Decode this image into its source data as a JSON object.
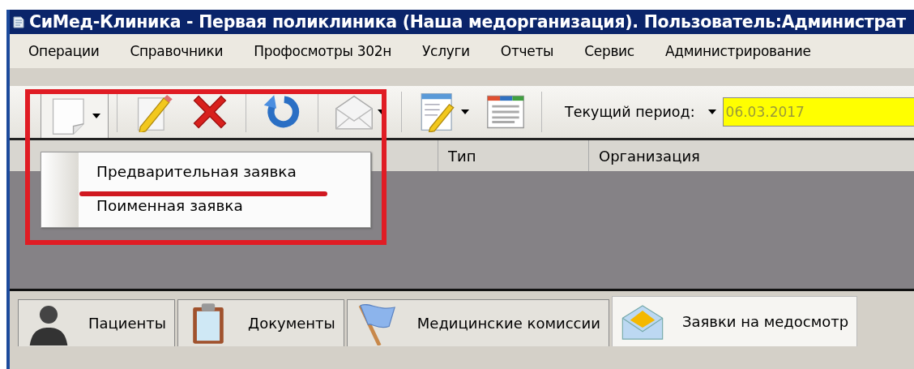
{
  "window": {
    "title": "СиМед-Клиника - Первая поликлиника (Наша медорганизация). Пользователь:Администрат"
  },
  "menu": [
    "Операции",
    "Справочники",
    "Профосмотры 302н",
    "Услуги",
    "Отчеты",
    "Сервис",
    "Администрирование"
  ],
  "toolbar": {
    "buttons": [
      {
        "kind": "new",
        "dropdown": true,
        "pressed": true
      },
      {
        "kind": "edit",
        "dropdown": false,
        "pressed": false
      },
      {
        "kind": "delete",
        "dropdown": false,
        "pressed": false
      },
      {
        "kind": "refresh",
        "dropdown": false,
        "pressed": false
      },
      {
        "kind": "mail",
        "dropdown": true,
        "pressed": false
      },
      {
        "kind": "list-edit",
        "dropdown": true,
        "pressed": false
      },
      {
        "kind": "form",
        "dropdown": false,
        "pressed": false
      }
    ],
    "period_label": "Текущий период:",
    "period_value": "06.03.2017"
  },
  "dropdown_menu": {
    "items": [
      {
        "label": "Предварительная заявка"
      },
      {
        "label": "Поименная заявка"
      }
    ]
  },
  "table": {
    "columns": [
      "Тип",
      "Организация"
    ]
  },
  "bottom_tabs": [
    {
      "label": "Пациенты",
      "kind": "person",
      "selected": false
    },
    {
      "label": "Документы",
      "kind": "clipboard",
      "selected": false
    },
    {
      "label": "Медицинские комиссии",
      "kind": "flag",
      "selected": false
    },
    {
      "label": "Заявки на медосмотр",
      "kind": "envelope",
      "selected": true
    }
  ],
  "annotations": {
    "highlight_frame": true,
    "underline": true
  }
}
